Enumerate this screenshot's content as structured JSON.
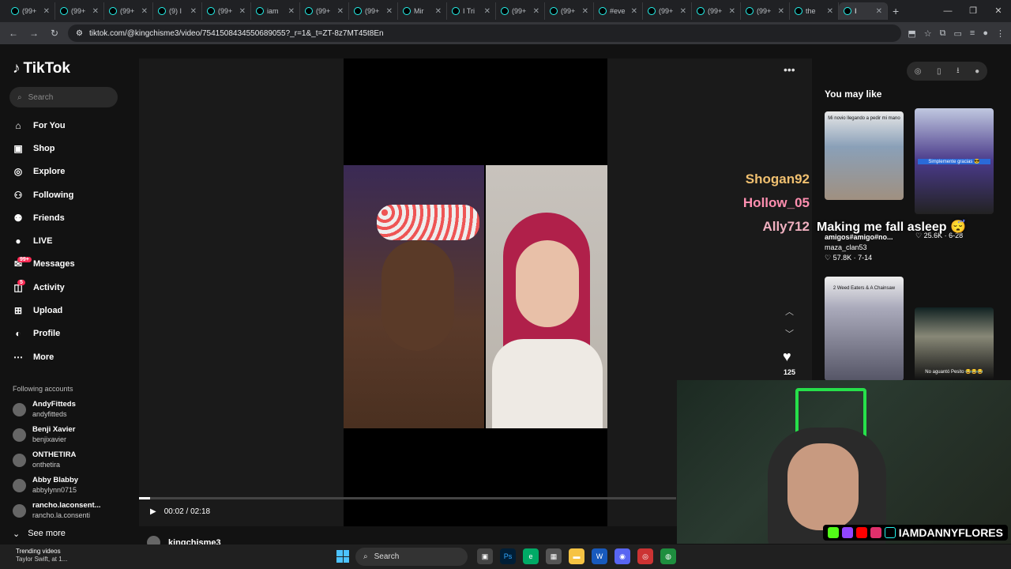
{
  "browser": {
    "tabs": [
      "(99+",
      "(99+",
      "(99+",
      "(9) I",
      "(99+",
      "iam",
      "(99+",
      "(99+",
      "Mir",
      "I Tri",
      "(99+",
      "(99+",
      "#eve",
      "(99+",
      "(99+",
      "(99+",
      "the",
      "I"
    ],
    "url": "tiktok.com/@kingchisme3/video/7541508434550689055?_r=1&_t=ZT-8z7MT45t8En"
  },
  "sidebar": {
    "logo": "TikTok",
    "search_placeholder": "Search",
    "nav": [
      {
        "label": "For You",
        "icon": "home-icon"
      },
      {
        "label": "Shop",
        "icon": "shop-icon"
      },
      {
        "label": "Explore",
        "icon": "compass-icon"
      },
      {
        "label": "Following",
        "icon": "following-icon"
      },
      {
        "label": "Friends",
        "icon": "friends-icon"
      },
      {
        "label": "LIVE",
        "icon": "live-icon"
      },
      {
        "label": "Messages",
        "icon": "messages-icon",
        "badge": "99+"
      },
      {
        "label": "Activity",
        "icon": "activity-icon",
        "badge": "5"
      },
      {
        "label": "Upload",
        "icon": "upload-icon"
      },
      {
        "label": "Profile",
        "icon": "profile-icon"
      },
      {
        "label": "More",
        "icon": "more-icon"
      }
    ],
    "following_heading": "Following accounts",
    "accounts": [
      {
        "name": "AndyFitteds",
        "handle": "andyfitteds"
      },
      {
        "name": "Benji Xavier",
        "handle": "benjixavier"
      },
      {
        "name": "ONTHETIRA",
        "handle": "onthetira"
      },
      {
        "name": "Abby Blabby",
        "handle": "abbylynn0715"
      },
      {
        "name": "rancho.laconsent...",
        "handle": "rancho.la.consenti"
      }
    ],
    "see_more": "See more"
  },
  "video": {
    "chat": [
      {
        "user": "Shogan92",
        "color": "#f0c070"
      },
      {
        "user": "Hollow_05",
        "color": "#ff8fb0"
      },
      {
        "user": "Ally712",
        "color": "#f0b0c0"
      }
    ],
    "caption": "Making me fall asleep 😴",
    "time": "00:02 / 02:18",
    "progress": 0.02,
    "likes": "125",
    "owner": "kingchisme3"
  },
  "you_may_like": {
    "heading": "You may like",
    "videos": [
      {
        "caption": "Mi novio llegando a pedir mi mano",
        "title": "amigos#amigo#no...",
        "author": "maza_clan53",
        "stats": "57.8K · 7-14"
      },
      {
        "caption": "Simplemente gracias 😎",
        "stats": "25.6K · 6-28"
      },
      {
        "caption": "2 Weed Eaters & A Chainsaw"
      },
      {
        "caption": "No aguantó Pesito 😂😂😂"
      }
    ]
  },
  "overlay": {
    "handle": "IAMDANNYFLORES"
  },
  "taskbar": {
    "trend_title": "Trending videos",
    "trend_sub": "Taylor Swift, at 1...",
    "search": "Search"
  }
}
